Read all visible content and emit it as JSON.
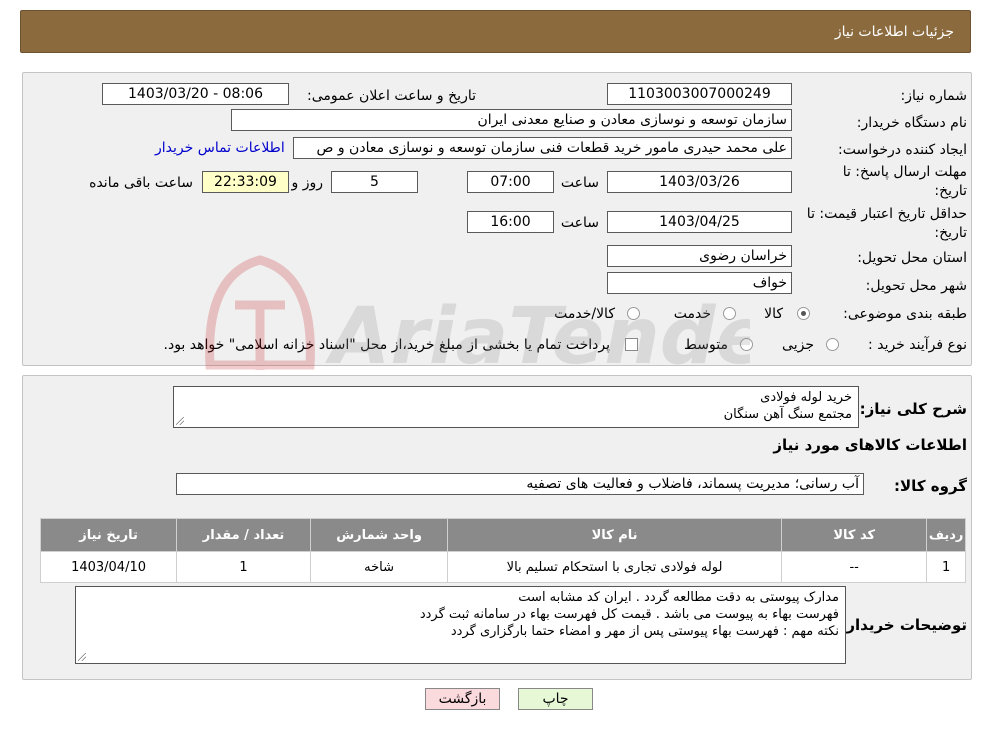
{
  "header": {
    "title": "جزئیات اطلاعات نیاز"
  },
  "form": {
    "need_number": {
      "label": "شماره نیاز:",
      "value": "1103003007000249"
    },
    "announce_datetime": {
      "label": "تاریخ و ساعت اعلان عمومی:",
      "value": "1403/03/20 - 08:06"
    },
    "buyer_org": {
      "label": "نام دستگاه خریدار:",
      "value": "سازمان توسعه و نوسازی معادن و صنایع معدنی ایران"
    },
    "requester": {
      "label": "ایجاد کننده درخواست:",
      "value": "علی محمد حیدری مامور خرید قطعات فنی سازمان توسعه و نوسازی معادن و ص",
      "contact_link": "اطلاعات تماس خریدار"
    },
    "response_deadline": {
      "label_line1": "مهلت ارسال پاسخ: تا",
      "label_line2": "تاریخ:",
      "date": "1403/03/26",
      "time_label": "ساعت",
      "time": "07:00",
      "days": "5",
      "days_label": "روز و",
      "remaining": "22:33:09",
      "remaining_label": "ساعت باقی مانده"
    },
    "price_validity": {
      "label_line1": "حداقل تاریخ اعتبار قیمت: تا",
      "label_line2": "تاریخ:",
      "date": "1403/04/25",
      "time_label": "ساعت",
      "time": "16:00"
    },
    "delivery_province": {
      "label": "استان محل تحویل:",
      "value": "خراسان رضوی"
    },
    "delivery_city": {
      "label": "شهر محل تحویل:",
      "value": "خواف"
    },
    "category": {
      "label": "طبقه بندی موضوعی:",
      "options": [
        "کالا",
        "خدمت",
        "کالا/خدمت"
      ],
      "selected": "کالا"
    },
    "purchase_type": {
      "label": "نوع فرآیند خرید :",
      "options": [
        "جزیی",
        "متوسط"
      ],
      "checkbox_text": "پرداخت تمام یا بخشی از مبلغ خرید،از محل \"اسناد خزانه اسلامی\" خواهد بود."
    }
  },
  "description": {
    "label": "شرح کلی نیاز:",
    "lines": [
      "خرید لوله فولادی",
      "مجتمع سنگ آهن سنگان"
    ]
  },
  "goods": {
    "section_title": "اطلاعات کالاهای مورد نیاز",
    "group_label": "گروه کالا:",
    "group_value": "آب رسانی؛ مدیریت پسماند، فاضلاب و فعالیت های تصفیه",
    "columns": [
      "ردیف",
      "کد کالا",
      "نام کالا",
      "واحد شمارش",
      "تعداد / مقدار",
      "تاریخ نیاز"
    ],
    "rows": [
      [
        "1",
        "--",
        "لوله فولادی تجاری با استحکام تسلیم بالا",
        "شاخه",
        "1",
        "1403/04/10"
      ]
    ]
  },
  "buyer_notes": {
    "label": "توضیحات خریدار:",
    "lines": [
      "مدارک پیوستی به دقت مطالعه گردد . ایران کد مشابه است",
      "فهرست بهاء به پیوست می باشد . قیمت کل فهرست بهاء در سامانه ثبت گردد",
      "نکته مهم : فهرست بهاء پیوستی پس از مهر و امضاء حتما بارگزاری گردد"
    ]
  },
  "buttons": {
    "back": "بازگشت",
    "print": "چاپ"
  },
  "colors": {
    "header_bg": "#8b6a3e",
    "table_header_bg": "#8a8a8a",
    "back_button_bg": "#fadadd",
    "print_button_bg": "#e6f8d6",
    "link": "#0000cc"
  },
  "watermark": {
    "text": "AriaTender.neT"
  }
}
